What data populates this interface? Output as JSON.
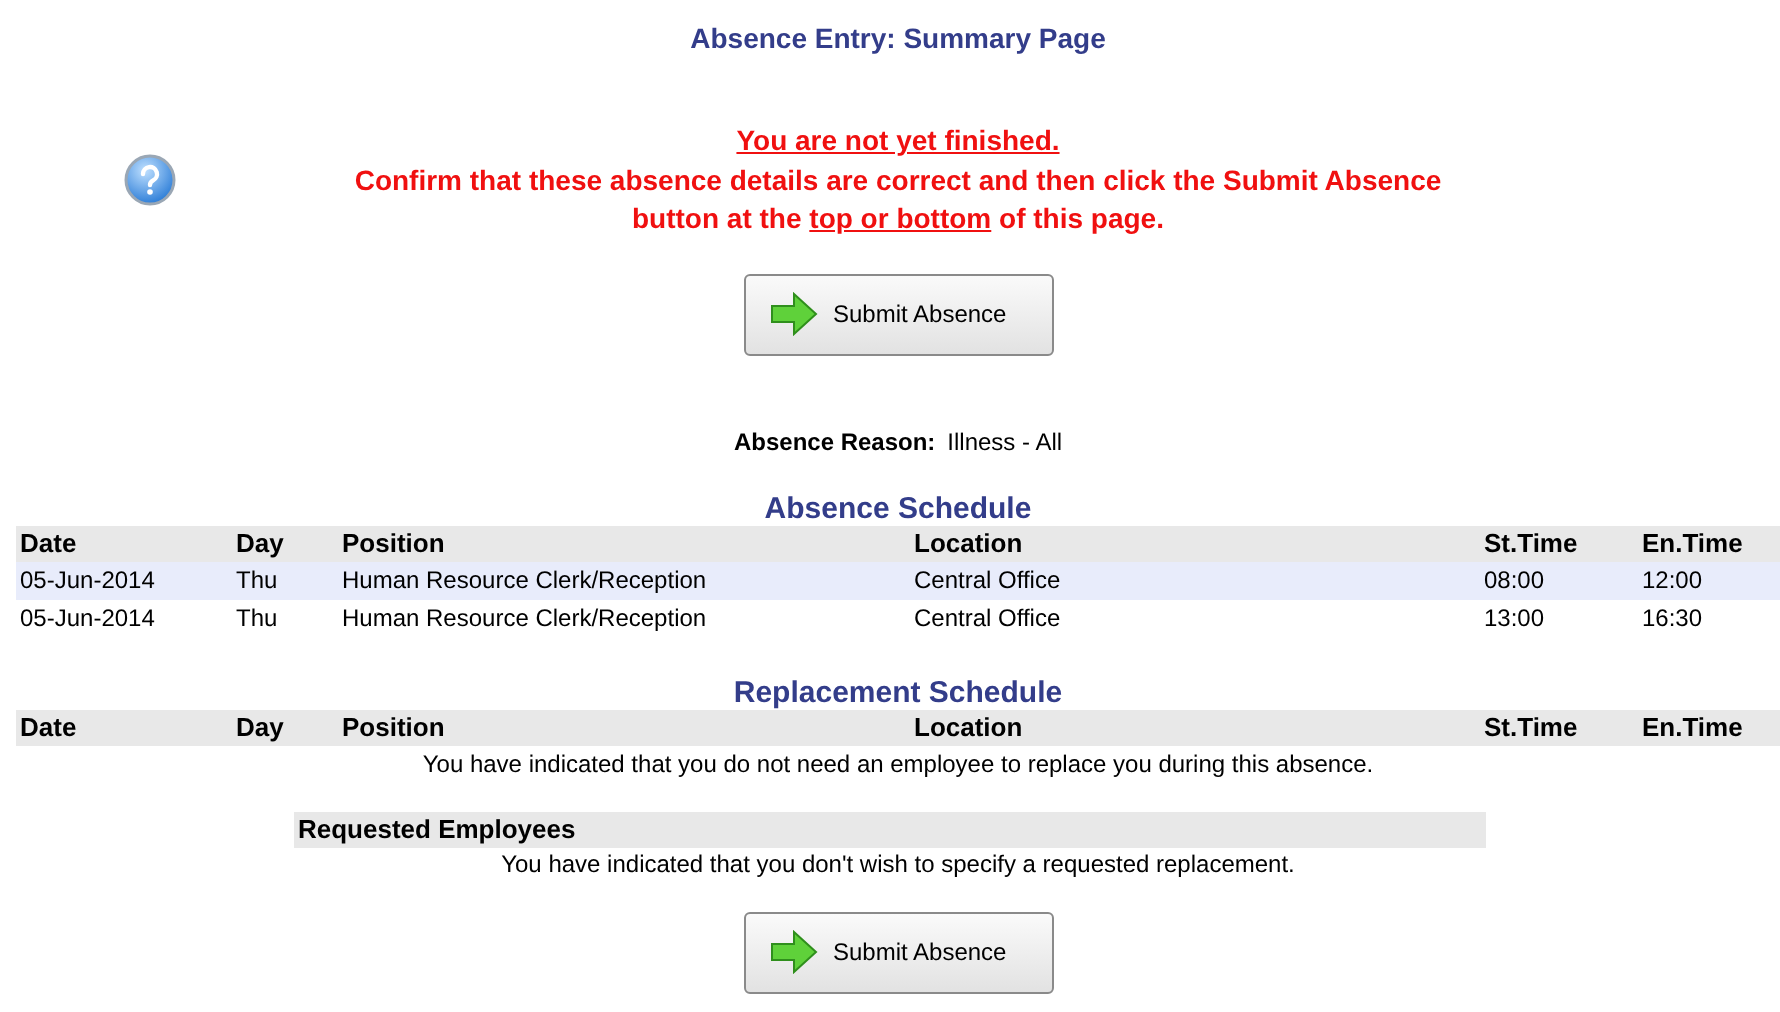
{
  "title": "Absence Entry: Summary Page",
  "warning": {
    "heading": "You are not yet finished.",
    "line1": "Confirm that these absence details are correct and then click the Submit Absence",
    "line2_before": "button at the ",
    "line2_link": "top or bottom",
    "line2_after": " of this page."
  },
  "submit_buttons": [
    "Submit Absence",
    "Submit Absence"
  ],
  "reason": {
    "label": "Absence Reason:",
    "value": "Illness - All"
  },
  "absence_schedule": {
    "title": "Absence Schedule",
    "columns": [
      "Date",
      "Day",
      "Position",
      "Location",
      "St.Time",
      "En.Time"
    ],
    "rows": [
      {
        "selected": true,
        "cells": [
          "05-Jun-2014",
          "Thu",
          "Human Resource Clerk/Reception",
          "Central Office",
          "08:00",
          "12:00"
        ]
      },
      {
        "selected": false,
        "cells": [
          "05-Jun-2014",
          "Thu",
          "Human Resource Clerk/Reception",
          "Central Office",
          "13:00",
          "16:30"
        ]
      }
    ]
  },
  "replacement_schedule": {
    "title": "Replacement Schedule",
    "columns": [
      "Date",
      "Day",
      "Position",
      "Location",
      "St.Time",
      "En.Time"
    ],
    "message": "You have indicated that you do not need an employee to replace you during this absence."
  },
  "requested_employees": {
    "title": "Requested Employees",
    "message": "You have indicated that you don't wish to specify a requested replacement."
  }
}
